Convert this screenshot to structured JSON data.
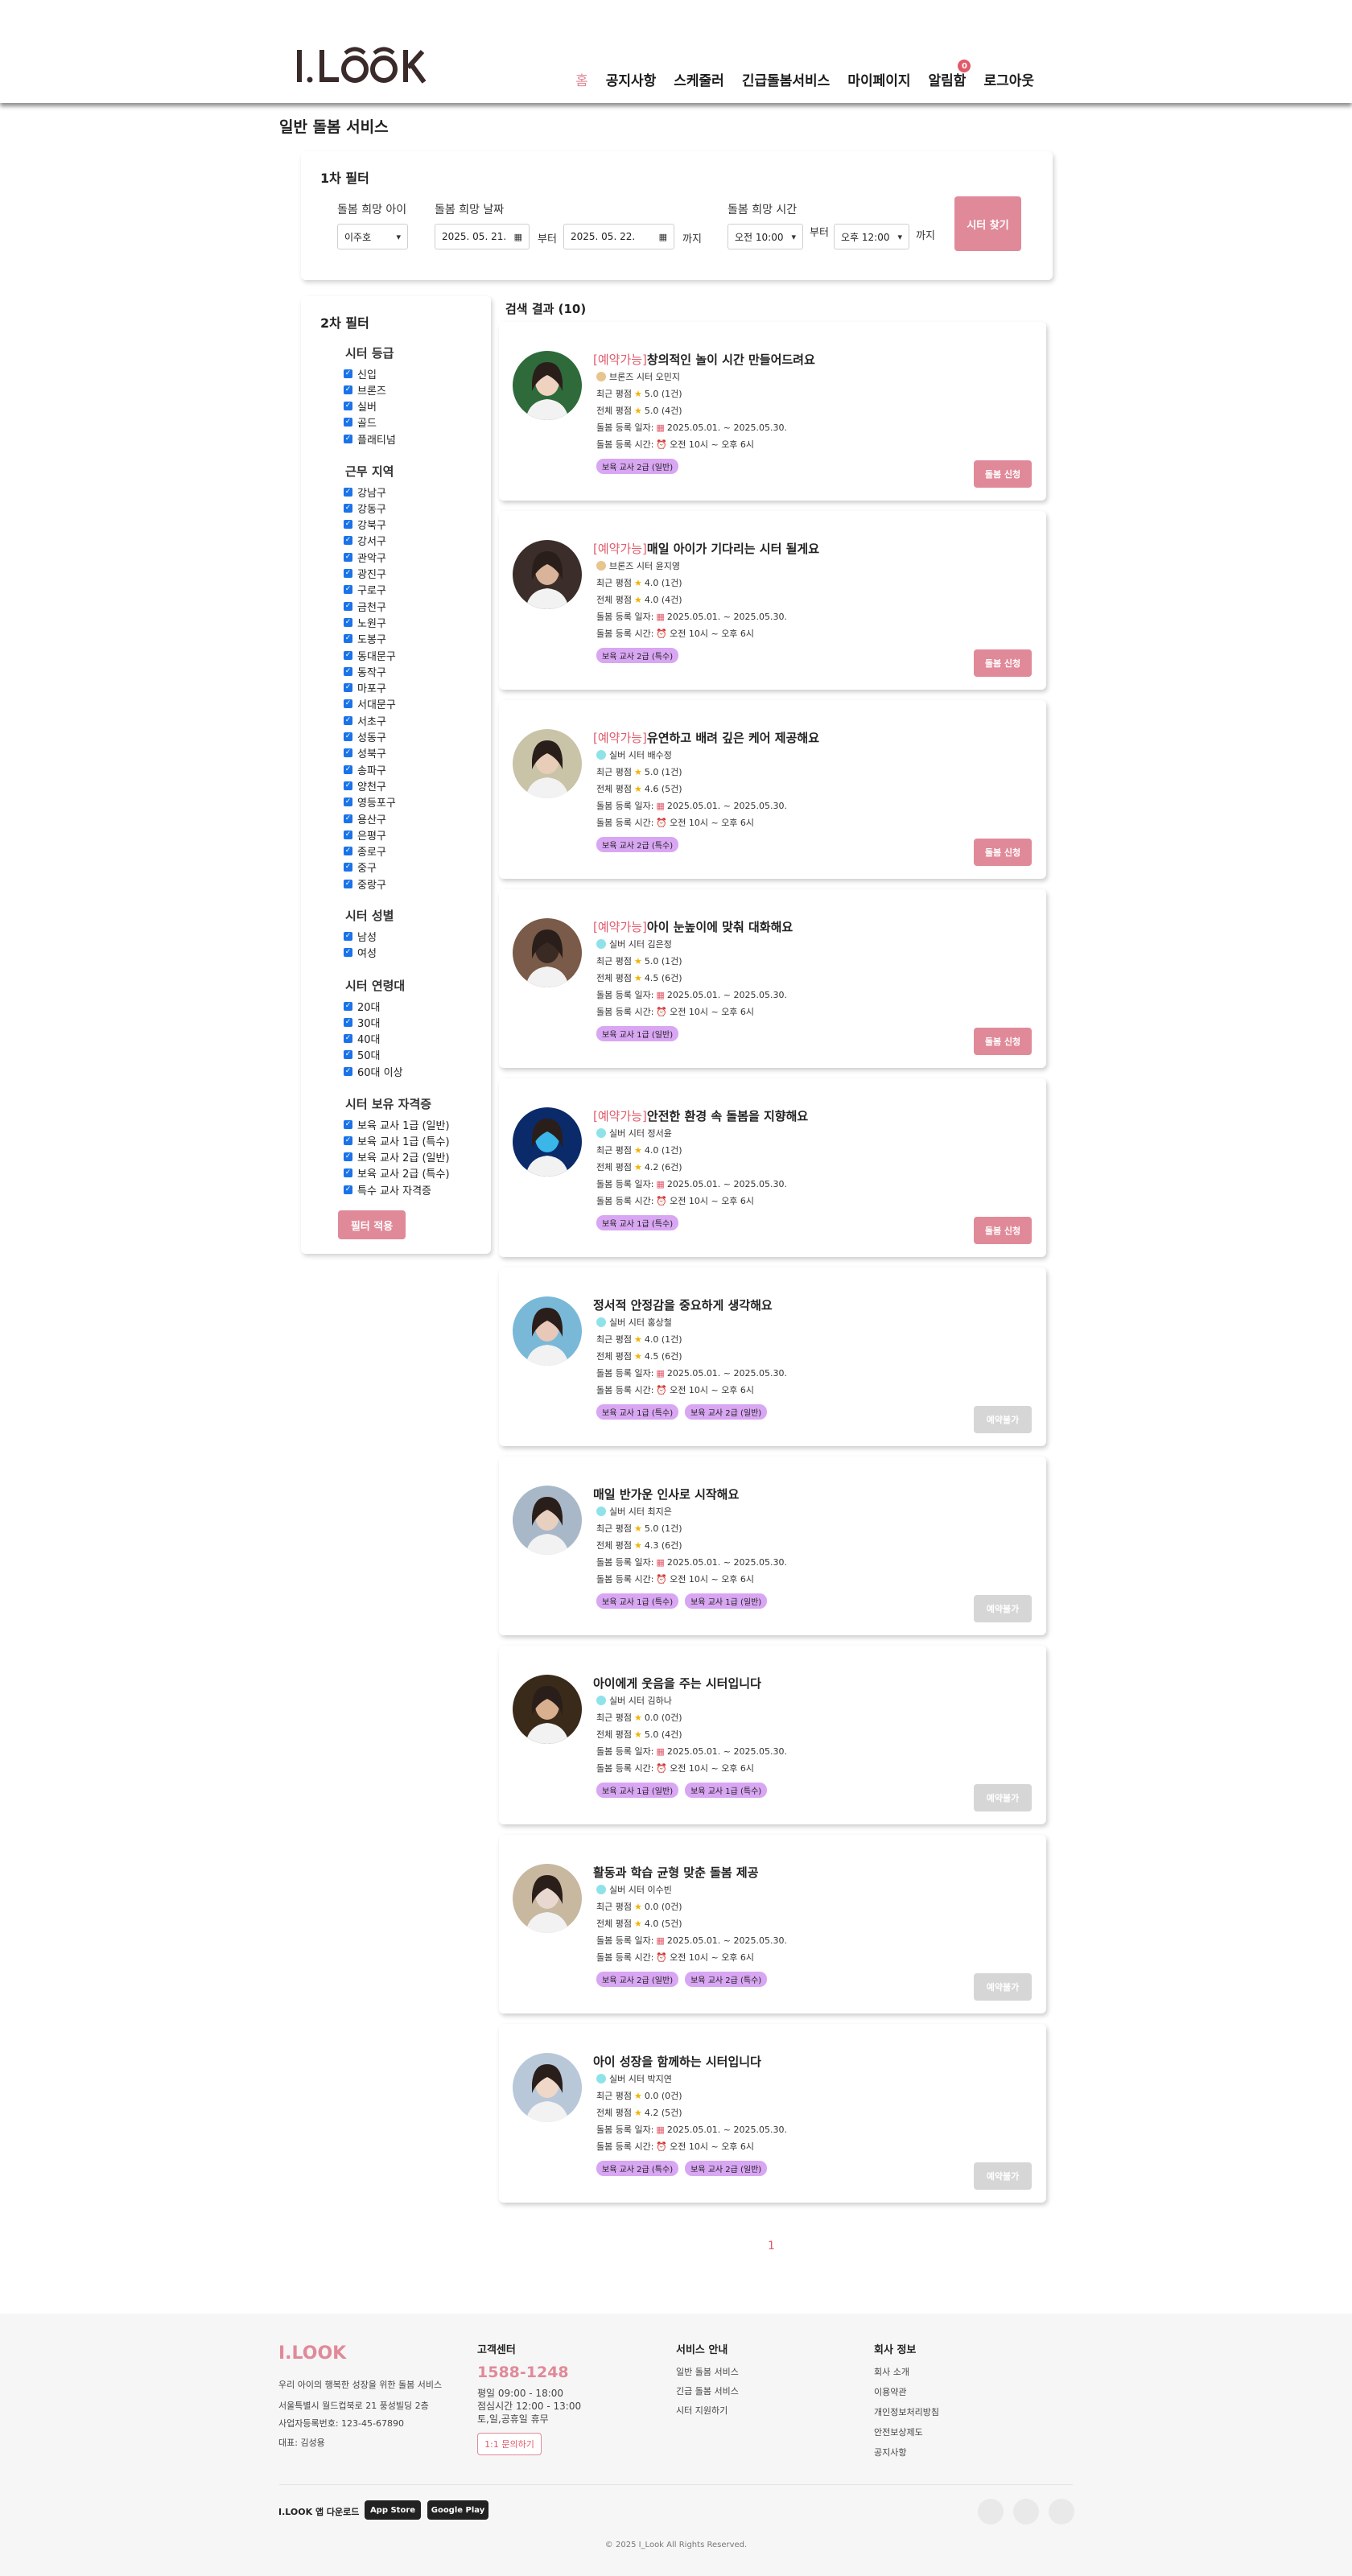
{
  "header": {
    "logo": "I.LOOK",
    "nav": [
      {
        "label": "홈",
        "active": true
      },
      {
        "label": "공지사항"
      },
      {
        "label": "스케줄러"
      },
      {
        "label": "긴급돌봄서비스"
      },
      {
        "label": "마이페이지"
      },
      {
        "label": "알림함",
        "badge": "0"
      },
      {
        "label": "로그아웃"
      }
    ]
  },
  "page_title": "일반 돌봄 서비스",
  "filter1": {
    "title": "1차 필터",
    "child_label": "돌봄 희망 아이",
    "child_value": "이주호",
    "date_label": "돌봄 희망 날짜",
    "date_from": "2025. 05. 21.",
    "date_from_suffix": "부터",
    "date_to": "2025. 05. 22.",
    "date_to_suffix": "까지",
    "time_label": "돌봄 희망 시간",
    "time_from": "오전 10:00",
    "time_from_suffix": "부터",
    "time_to": "오후 12:00",
    "time_to_suffix": "까지",
    "search_button": "시터 찾기"
  },
  "filter2": {
    "title": "2차 필터",
    "grade_title": "시터 등급",
    "grades": [
      "신입",
      "브론즈",
      "실버",
      "골드",
      "플래티넘"
    ],
    "region_title": "근무 지역",
    "regions": [
      "강남구",
      "강동구",
      "강북구",
      "강서구",
      "관악구",
      "광진구",
      "구로구",
      "금천구",
      "노원구",
      "도봉구",
      "동대문구",
      "동작구",
      "마포구",
      "서대문구",
      "서초구",
      "성동구",
      "성북구",
      "송파구",
      "양천구",
      "영등포구",
      "용산구",
      "은평구",
      "종로구",
      "중구",
      "중랑구"
    ],
    "gender_title": "시터 성별",
    "genders": [
      "남성",
      "여성"
    ],
    "age_title": "시터 연령대",
    "ages": [
      "20대",
      "30대",
      "40대",
      "50대",
      "60대 이상"
    ],
    "cert_title": "시터 보유 자격증",
    "certs": [
      "보육 교사 1급 (일반)",
      "보육 교사 1급 (특수)",
      "보육 교사 2급 (일반)",
      "보육 교사 2급 (특수)",
      "특수 교사 자격증"
    ],
    "apply_button": "필터 적용"
  },
  "results": {
    "title": "검색 결과 (10)",
    "labels": {
      "recent": "최근 평점",
      "total": "전체 평점",
      "period": "돌봄 등록 일자:",
      "time": "돌봄 등록 시간:"
    },
    "items": [
      {
        "tag": "[예약가능]",
        "title": "창의적인 놀이 시간 만들어드려요",
        "grade": "브론즈 시터 오민지",
        "grade_color": "#e8c58f",
        "recent": "5.0 (1건)",
        "total": "5.0 (4건)",
        "period": "2025.05.01. ~ 2025.05.30.",
        "time": "오전 10시 ~ 오후 6시",
        "chips": [
          "보육 교사 2급 (일반)"
        ],
        "button": "돌봄 신청",
        "enabled": true,
        "avatar_bg": "#2e6a3a",
        "avatar_face": "#f0d2c0"
      },
      {
        "tag": "[예약가능]",
        "title": "매일 아이가 기다리는 시터 될게요",
        "grade": "브론즈 시터 윤지영",
        "grade_color": "#e8c58f",
        "recent": "4.0 (1건)",
        "total": "4.0 (4건)",
        "period": "2025.05.01. ~ 2025.05.30.",
        "time": "오전 10시 ~ 오후 6시",
        "chips": [
          "보육 교사 2급 (특수)"
        ],
        "button": "돌봄 신청",
        "enabled": true,
        "avatar_bg": "#3b2e2a",
        "avatar_face": "#d9b49a"
      },
      {
        "tag": "[예약가능]",
        "title": "유연하고 배려 깊은 케어 제공해요",
        "grade": "실버 시터 배수정",
        "grade_color": "#8fe3e8",
        "recent": "5.0 (1건)",
        "total": "4.6 (5건)",
        "period": "2025.05.01. ~ 2025.05.30.",
        "time": "오전 10시 ~ 오후 6시",
        "chips": [
          "보육 교사 2급 (특수)"
        ],
        "button": "돌봄 신청",
        "enabled": true,
        "avatar_bg": "#c9c3a8",
        "avatar_face": "#e8cdb8"
      },
      {
        "tag": "[예약가능]",
        "title": "아이 눈높이에 맞춰 대화해요",
        "grade": "실버 시터 김은정",
        "grade_color": "#8fe3e8",
        "recent": "5.0 (1건)",
        "total": "4.5 (6건)",
        "period": "2025.05.01. ~ 2025.05.30.",
        "time": "오전 10시 ~ 오후 6시",
        "chips": [
          "보육 교사 1급 (일반)"
        ],
        "button": "돌봄 신청",
        "enabled": true,
        "avatar_bg": "#7a5a48",
        "avatar_face": "#3a2a24"
      },
      {
        "tag": "[예약가능]",
        "title": "안전한 환경 속 돌봄을 지향해요",
        "grade": "실버 시터 정서윤",
        "grade_color": "#8fe3e8",
        "recent": "4.0 (1건)",
        "total": "4.2 (6건)",
        "period": "2025.05.01. ~ 2025.05.30.",
        "time": "오전 10시 ~ 오후 6시",
        "chips": [
          "보육 교사 1급 (특수)"
        ],
        "button": "돌봄 신청",
        "enabled": true,
        "avatar_bg": "#0a2a6a",
        "avatar_face": "#3ab6e8"
      },
      {
        "tag": "",
        "title": "정서적 안정감을 중요하게 생각해요",
        "grade": "실버 시터 홍상철",
        "grade_color": "#8fe3e8",
        "recent": "4.0 (1건)",
        "total": "4.5 (6건)",
        "period": "2025.05.01. ~ 2025.05.30.",
        "time": "오전 10시 ~ 오후 6시",
        "chips": [
          "보육 교사 1급 (특수)",
          "보육 교사 2급 (일반)"
        ],
        "button": "예약불가",
        "enabled": false,
        "avatar_bg": "#7ab8d8",
        "avatar_face": "#e8c8b8"
      },
      {
        "tag": "",
        "title": "매일 반가운 인사로 시작해요",
        "grade": "실버 시터 최지은",
        "grade_color": "#8fe3e8",
        "recent": "5.0 (1건)",
        "total": "4.3 (6건)",
        "period": "2025.05.01. ~ 2025.05.30.",
        "time": "오전 10시 ~ 오후 6시",
        "chips": [
          "보육 교사 1급 (특수)",
          "보육 교사 1급 (일반)"
        ],
        "button": "예약불가",
        "enabled": false,
        "avatar_bg": "#a8b8c8",
        "avatar_face": "#e8d0c0"
      },
      {
        "tag": "",
        "title": "아이에게 웃음을 주는 시터입니다",
        "grade": "실버 시터 김하나",
        "grade_color": "#8fe3e8",
        "recent": "0.0 (0건)",
        "total": "5.0 (4건)",
        "period": "2025.05.01. ~ 2025.05.30.",
        "time": "오전 10시 ~ 오후 6시",
        "chips": [
          "보육 교사 1급 (일반)",
          "보육 교사 1급 (특수)"
        ],
        "button": "예약불가",
        "enabled": false,
        "avatar_bg": "#3a2a1a",
        "avatar_face": "#d8b090"
      },
      {
        "tag": "",
        "title": "활동과 학습 균형 맞춘 돌봄 제공",
        "grade": "실버 시터 이수빈",
        "grade_color": "#8fe3e8",
        "recent": "0.0 (0건)",
        "total": "4.0 (5건)",
        "period": "2025.05.01. ~ 2025.05.30.",
        "time": "오전 10시 ~ 오후 6시",
        "chips": [
          "보육 교사 2급 (일반)",
          "보육 교사 2급 (특수)"
        ],
        "button": "예약불가",
        "enabled": false,
        "avatar_bg": "#c8b8a0",
        "avatar_face": "#e8d8d0"
      },
      {
        "tag": "",
        "title": "아이 성장을 함께하는 시터입니다",
        "grade": "실버 시터 박지연",
        "grade_color": "#8fe3e8",
        "recent": "0.0 (0건)",
        "total": "4.2 (5건)",
        "period": "2025.05.01. ~ 2025.05.30.",
        "time": "오전 10시 ~ 오후 6시",
        "chips": [
          "보육 교사 2급 (특수)",
          "보육 교사 2급 (일반)"
        ],
        "button": "예약불가",
        "enabled": false,
        "avatar_bg": "#b8c8d8",
        "avatar_face": "#f0d8c8"
      }
    ]
  },
  "pagination": {
    "current": "1"
  },
  "footer": {
    "logo": "I.LOOK",
    "slogan": "우리 아이의 행복한 성장을 위한 돌봄 서비스",
    "address": "서울특별시 월드컵북로 21 풍성빌딩 2층",
    "business_no": "사업자등록번호: 123-45-67890",
    "ceo": "대표: 김성용",
    "cs_title": "고객센터",
    "phone": "1588-1248",
    "hours1": "평일 09:00 - 18:00",
    "hours2": "점심시간 12:00 - 13:00",
    "hours3": "토,일,공휴일 휴무",
    "inquiry_button": "1:1 문의하기",
    "service_title": "서비스 안내",
    "service_links": [
      "일반 돌봄 서비스",
      "긴급 돌봄 서비스",
      "시터 지원하기"
    ],
    "company_title": "회사 정보",
    "company_links": [
      "회사 소개",
      "이용약관",
      "개인정보처리방침",
      "안전보상제도",
      "공지사항"
    ],
    "app_download": "I.LOOK 앱 다운로드",
    "app_store": "App Store",
    "google_play": "Google Play",
    "copyright": "© 2025 I_Look All Rights Reserved."
  },
  "colors": {
    "accent": "#e08a99",
    "available_tag": "#e05a6a",
    "chip": "#d8a6f2",
    "disabled": "#d6d6d6",
    "checkbox": "#1a73e8"
  }
}
